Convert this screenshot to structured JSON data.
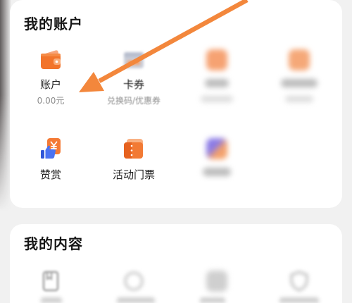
{
  "colors": {
    "background": "#f1f1f1",
    "card": "#ffffff",
    "title_text": "#161616",
    "label_text": "#1f1f1f",
    "sub_text": "#8c8c8c",
    "accent_orange": "#f2742b",
    "annotation_arrow": "#f3873c"
  },
  "account_section": {
    "title": "我的账户",
    "items": [
      {
        "label": "账户",
        "sublabel": "0.00元",
        "icon": "wallet-icon"
      },
      {
        "label": "卡券",
        "sublabel": "兑换码/优惠券",
        "icon": "coupon-icon",
        "blurred": true
      },
      {
        "icon": "blurred-icon",
        "blurred": true
      },
      {
        "icon": "blurred-icon",
        "blurred": true
      },
      {
        "label": "赞赏",
        "icon": "appreciation-icon"
      },
      {
        "label": "活动门票",
        "icon": "ticket-icon"
      },
      {
        "icon": "blurred-icon",
        "blurred": true
      }
    ]
  },
  "content_section": {
    "title": "我的内容",
    "items": [
      {
        "icon": "bookmark-icon",
        "blurred": true
      },
      {
        "icon": "circle-icon",
        "blurred": true
      },
      {
        "icon": "blurred-icon",
        "blurred": true
      },
      {
        "icon": "shield-icon",
        "blurred": true
      }
    ]
  }
}
